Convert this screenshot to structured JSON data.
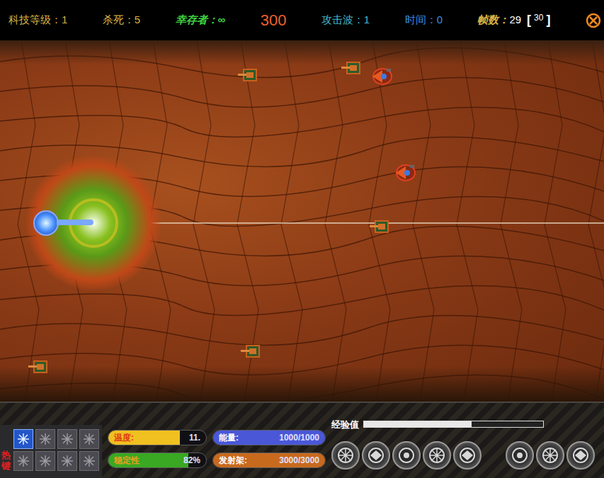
{
  "top_bar": {
    "stats": [
      {
        "kind": "stat",
        "label": "科技等级：",
        "value": "1",
        "color": "#d9b445"
      },
      {
        "kind": "stat",
        "label": "杀死：",
        "value": "5",
        "color": "#d9b445"
      },
      {
        "kind": "stat",
        "label": "幸存者：",
        "value": "∞",
        "color": "#3fd23f"
      },
      {
        "kind": "score",
        "label": "",
        "value": "300",
        "color": "#f0602a"
      },
      {
        "kind": "stat",
        "label": "攻击波：",
        "value": "1",
        "color": "#46bcd0"
      },
      {
        "kind": "stat",
        "label": "时间：",
        "value": "0",
        "color": "#3a8fe0"
      }
    ],
    "frames": {
      "label": "帧数：",
      "value": "29",
      "open": "[",
      "target": "30",
      "close": "]"
    }
  },
  "battlefield": {
    "enemies": [
      {
        "kind": "tank"
      },
      {
        "kind": "tank"
      },
      {
        "kind": "craft"
      },
      {
        "kind": "craft"
      },
      {
        "kind": "tank"
      },
      {
        "kind": "tank"
      },
      {
        "kind": "tank"
      }
    ],
    "player": {
      "laser": true
    }
  },
  "hud": {
    "hotkey_label": "热键",
    "hotkeys": [
      {
        "selected": true
      },
      {
        "selected": false
      },
      {
        "selected": false
      },
      {
        "selected": false
      },
      {
        "selected": false
      },
      {
        "selected": false
      },
      {
        "selected": false
      },
      {
        "selected": false
      }
    ],
    "gauges": [
      {
        "label": "温度:",
        "reading": "11.",
        "level": 0.73,
        "color": "#f0c020",
        "label_color": "#e03818"
      },
      {
        "label": "稳定性",
        "reading": "82%",
        "level": 0.82,
        "color": "#3aa822",
        "label_color": "#e8a020"
      }
    ],
    "resources": [
      {
        "label": "能量:",
        "reading": "1000/1000",
        "level": 1,
        "color": "#4a58d8"
      },
      {
        "label": "发射架:",
        "reading": "3000/3000",
        "level": 1,
        "color": "#c86a1e"
      }
    ],
    "experience": {
      "label": "经验值",
      "level": 0.6
    }
  }
}
